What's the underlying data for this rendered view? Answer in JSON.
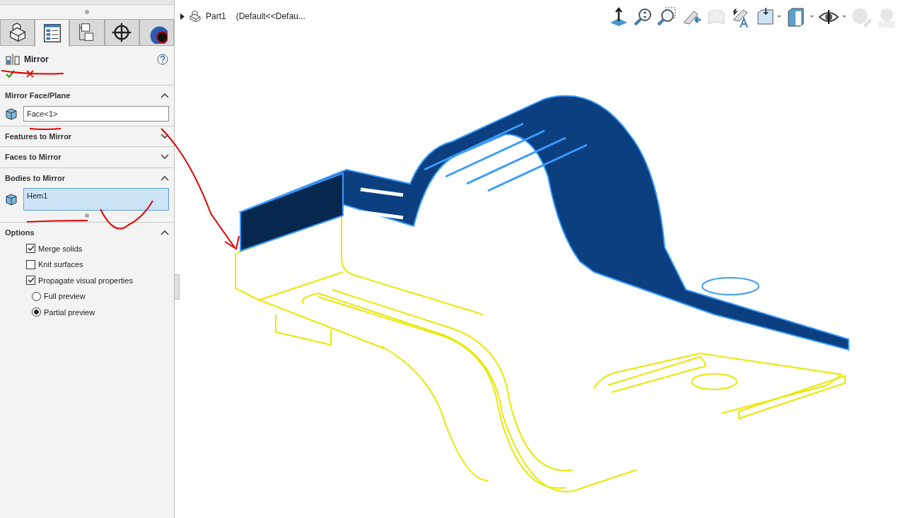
{
  "panel_tabs": [
    {
      "selected": false
    },
    {
      "selected": true
    },
    {
      "selected": false
    },
    {
      "selected": false
    },
    {
      "selected": false
    }
  ],
  "feature": {
    "title": "Mirror"
  },
  "sections": [
    {
      "title": "Mirror Face/Plane",
      "expanded": true,
      "kind": "field",
      "value": "Face<1>",
      "active": false
    },
    {
      "title": "Features to Mirror",
      "expanded": false
    },
    {
      "title": "Faces to Mirror",
      "expanded": false
    },
    {
      "title": "Bodies to Mirror",
      "expanded": true,
      "kind": "field",
      "value": "Hem1",
      "active": true
    },
    {
      "title": "Options",
      "expanded": true,
      "kind": "options",
      "items": [
        {
          "kind": "checkbox",
          "label": "Merge solids",
          "checked": true
        },
        {
          "kind": "checkbox",
          "label": "Knit surfaces",
          "checked": false
        },
        {
          "kind": "checkbox",
          "label": "Propagate visual properties",
          "checked": true
        },
        {
          "kind": "radio",
          "label": "Full preview",
          "selected": false
        },
        {
          "kind": "radio",
          "label": "Partial preview",
          "selected": true
        }
      ]
    }
  ],
  "tree": {
    "name": "Part1",
    "config": "(Default<<Defau..."
  }
}
